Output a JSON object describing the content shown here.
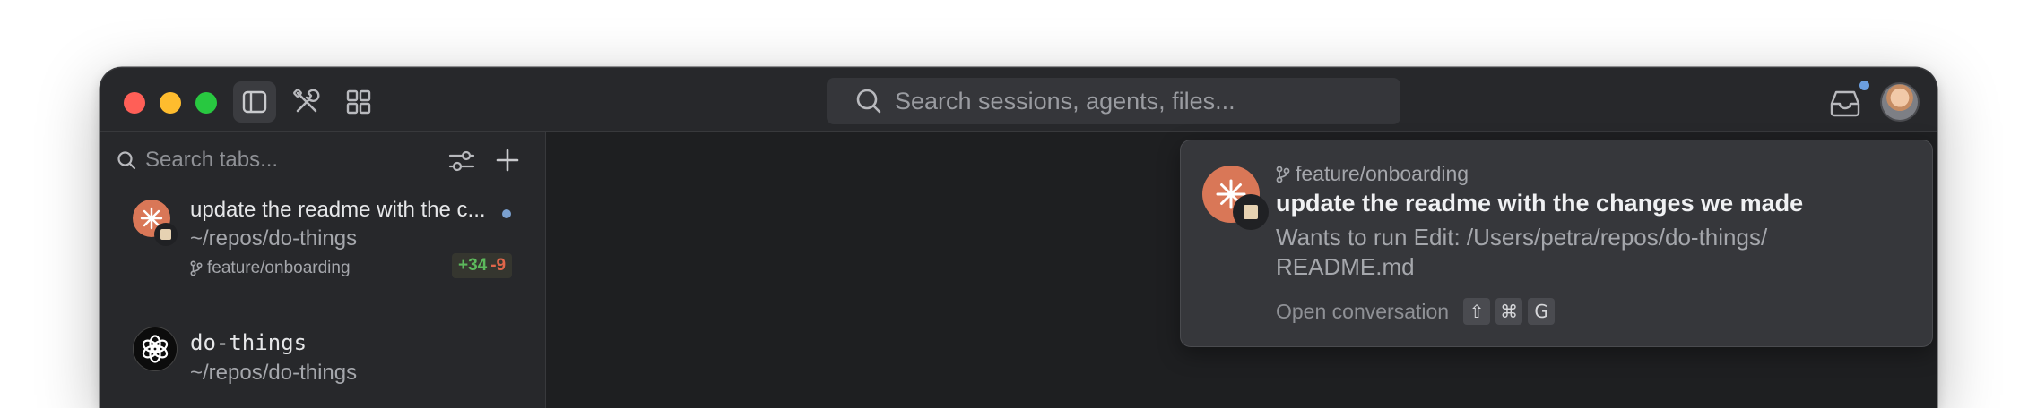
{
  "titlebar": {
    "search_placeholder": "Search sessions, agents, files..."
  },
  "sidebar": {
    "search_placeholder": "Search tabs...",
    "sessions": [
      {
        "title": "update the readme with the c...",
        "path": "~/repos/do-things",
        "branch": "feature/onboarding",
        "additions": "+34",
        "deletions": "-9",
        "unread": true,
        "agent_icon": "claude-sparkle-icon"
      },
      {
        "title": "do-things",
        "path": "~/repos/do-things",
        "agent_icon": "openai-logo-icon"
      }
    ]
  },
  "notification": {
    "branch": "feature/onboarding",
    "title": "update the readme with the changes we made",
    "description": "Wants to run Edit: /Users/petra/repos/do-things/ README.md",
    "action_label": "Open conversation",
    "shortcut_keys": [
      "⇧",
      "⌘",
      "G"
    ]
  },
  "colors": {
    "agent_accent": "#d97757",
    "additions": "#5cb85c",
    "deletions": "#e0664a",
    "unread_dot": "#7aa0cf"
  }
}
